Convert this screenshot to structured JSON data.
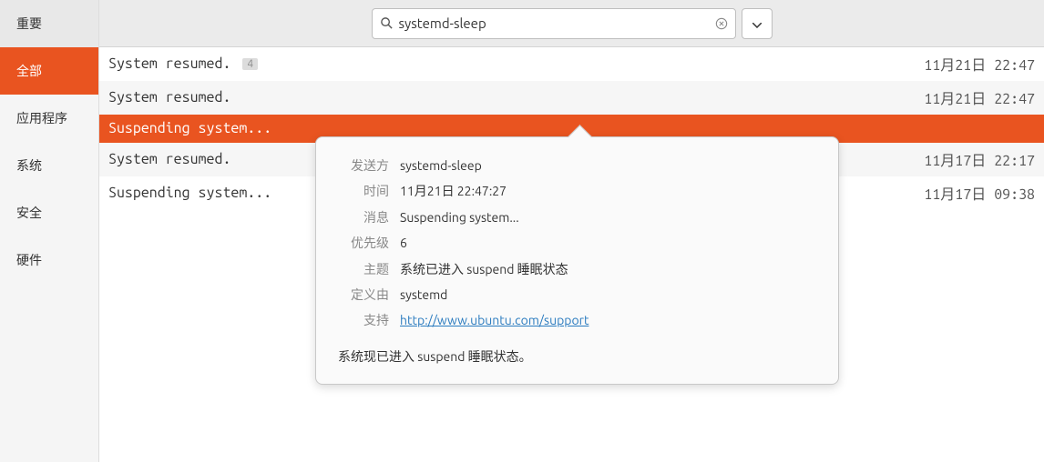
{
  "sidebar": {
    "items": [
      {
        "label": "重要",
        "active": false
      },
      {
        "label": "全部",
        "active": true
      },
      {
        "label": "应用程序",
        "active": false
      },
      {
        "label": "系统",
        "active": false
      },
      {
        "label": "安全",
        "active": false
      },
      {
        "label": "硬件",
        "active": false
      }
    ]
  },
  "search": {
    "value": "systemd-sleep"
  },
  "logs": [
    {
      "msg": "System resumed.",
      "badge": "4",
      "date": "11月21日 22:47",
      "selected": false
    },
    {
      "msg": "System resumed.",
      "badge": null,
      "date": "11月21日 22:47",
      "selected": false
    },
    {
      "msg": "Suspending system...",
      "badge": null,
      "date": "",
      "selected": true
    },
    {
      "msg": "System resumed.",
      "badge": null,
      "date": "11月17日 22:17",
      "selected": false
    },
    {
      "msg": "Suspending system...",
      "badge": null,
      "date": "11月17日 09:38",
      "selected": false
    }
  ],
  "popover": {
    "labels": {
      "sender": "发送方",
      "time": "时间",
      "message": "消息",
      "priority": "优先级",
      "subject": "主题",
      "defined_by": "定义由",
      "support": "支持"
    },
    "values": {
      "sender": "systemd-sleep",
      "time": "11月21日 22:47:27",
      "message": "Suspending system...",
      "priority": "6",
      "subject": "系统已进入 suspend 睡眠状态",
      "defined_by": "systemd",
      "support": "http://www.ubuntu.com/support"
    },
    "body": "系统现已进入 suspend 睡眠状态。"
  }
}
